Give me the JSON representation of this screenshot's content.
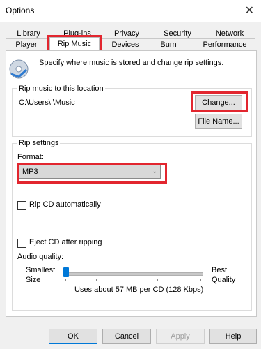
{
  "window": {
    "title": "Options",
    "close_glyph": "✕"
  },
  "tabs_row1": [
    "Library",
    "Plug-ins",
    "Privacy",
    "Security",
    "Network"
  ],
  "tabs_row2": [
    "Player",
    "Rip Music",
    "Devices",
    "Burn",
    "Performance"
  ],
  "active_tab": "Rip Music",
  "header": {
    "icon": "disc-rip-icon",
    "text": "Specify where music is stored and change rip settings."
  },
  "location_group": {
    "label": "Rip music to this location",
    "path": "C:\\Users\\      \\Music",
    "change_button": "Change...",
    "filename_button": "File Name..."
  },
  "rip_settings": {
    "label": "Rip settings",
    "format_label": "Format:",
    "format_value": "MP3",
    "rip_cd_auto": {
      "label": "Rip CD automatically",
      "checked": false
    },
    "eject_cd": {
      "label": "Eject CD after ripping",
      "checked": false
    },
    "audio_quality_label": "Audio quality:",
    "quality_min_label_1": "Smallest",
    "quality_min_label_2": "Size",
    "quality_max_label_1": "Best",
    "quality_max_label_2": "Quality",
    "quality_level": 0.0,
    "quality_desc": "Uses about 57 MB per CD (128 Kbps)"
  },
  "buttons": {
    "ok": "OK",
    "cancel": "Cancel",
    "apply": "Apply",
    "help": "Help"
  },
  "colors": {
    "highlight": "#e2262f",
    "accent": "#0078d7"
  }
}
